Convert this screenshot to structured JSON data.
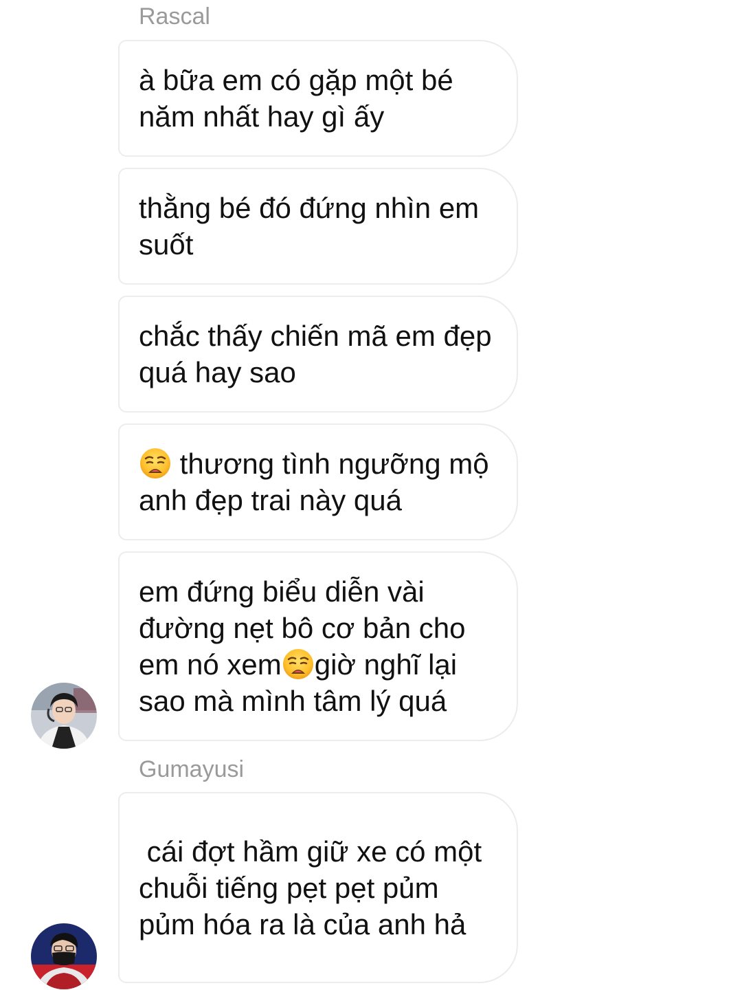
{
  "thread": {
    "groups": [
      {
        "sender": "Rascal",
        "messages": [
          "à bữa em có gặp một bé năm nhất hay gì ấy",
          "thằng bé đó đứng nhìn em suốt",
          "chắc thấy chiến mã em đẹp quá hay sao",
          "thương tình ngưỡng mộ anh đẹp trai này quá",
          {
            "before": "em đứng biểu diễn vài đường nẹt bô cơ bản cho em nó xem",
            "after": "giờ nghĩ lại sao mà mình tâm lý quá"
          }
        ]
      },
      {
        "sender": "Gumayusi",
        "messages": [
          " cái đợt hầm giữ xe có một chuỗi tiếng pẹt pẹt pủm pủm hóa ra là của anh hả"
        ]
      }
    ],
    "emoji": "weary-face",
    "colors": {
      "bubble_border": "#ececec",
      "sender_name": "#9a9a9a",
      "text": "#111111",
      "background": "#ffffff"
    }
  }
}
